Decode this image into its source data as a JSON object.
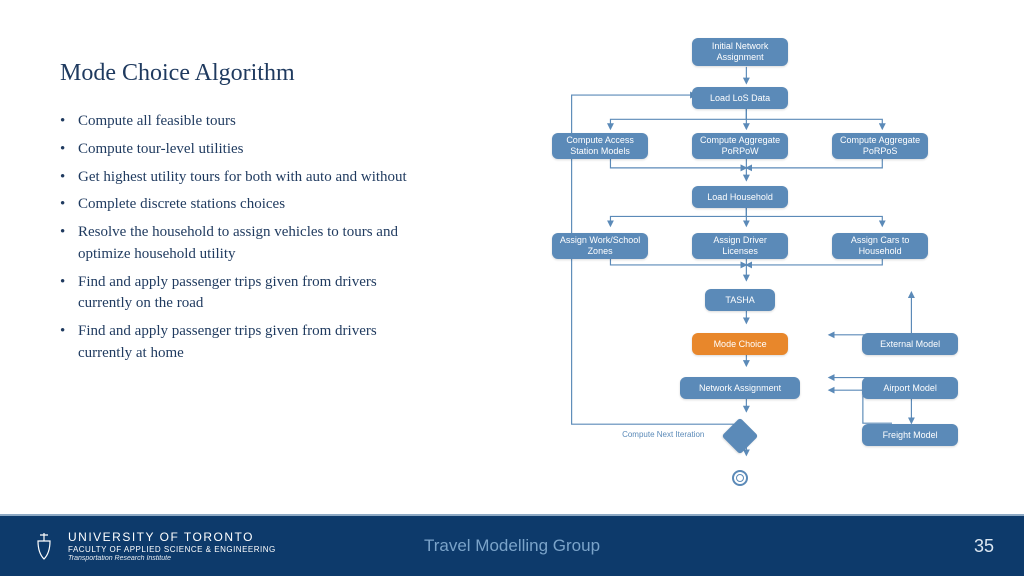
{
  "title": "Mode Choice Algorithm",
  "bullets": [
    "Compute all feasible tours",
    "Compute tour-level utilities",
    "Get highest utility tours for both with auto and without",
    "Complete discrete stations choices",
    "Resolve the household to assign vehicles to tours and optimize household utility",
    "Find and apply passenger trips given from drivers currently on the road",
    "Find and apply passenger trips given from drivers currently at home"
  ],
  "nodes": {
    "initial": "Initial Network Assignment",
    "loadlos": "Load LoS Data",
    "access": "Compute Access Station Models",
    "porpow": "Compute Aggregate PoRPoW",
    "porpos": "Compute Aggregate PoRPoS",
    "loadhh": "Load Household",
    "workzones": "Assign Work/School Zones",
    "drivlic": "Assign Driver Licenses",
    "assigncars": "Assign Cars to Household",
    "tasha": "TASHA",
    "modechoice": "Mode Choice",
    "netassign": "Network Assignment",
    "external": "External Model",
    "airport": "Airport Model",
    "freight": "Freight Model"
  },
  "iterlabel": "Compute Next Iteration",
  "footer": {
    "org1": "UNIVERSITY OF TORONTO",
    "org2": "FACULTY OF APPLIED SCIENCE & ENGINEERING",
    "org3": "Transportation Research Institute",
    "group": "Travel Modelling Group",
    "page": "35"
  }
}
